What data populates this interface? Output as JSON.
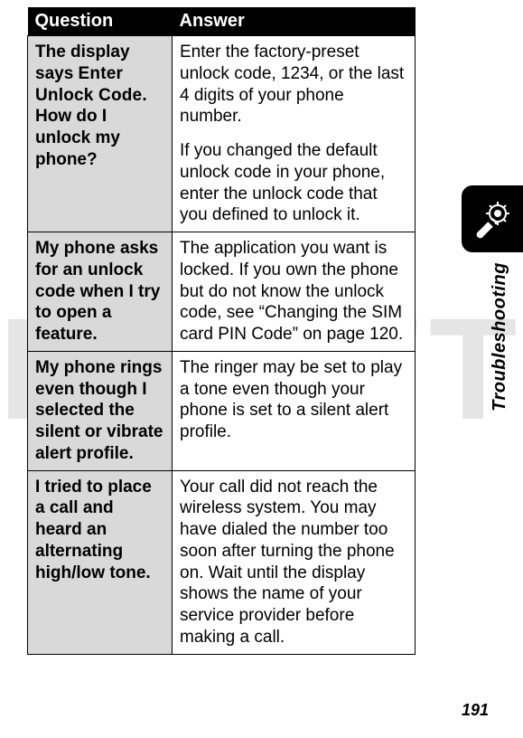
{
  "watermark": "DRAFT",
  "table": {
    "headers": {
      "question": "Question",
      "answer": "Answer"
    },
    "rows": [
      {
        "question_pre": "The display says ",
        "question_mono": "Enter Unlock Code",
        "question_post": ". How do I unlock my phone?",
        "answer_p1": "Enter the factory-preset unlock code, 1234, or the last 4 digits of your phone number.",
        "answer_p2": "If you changed the default unlock code in your phone, enter the unlock code that you defined to unlock it."
      },
      {
        "question": "My phone asks for an unlock code when I try to open a feature.",
        "answer": "The application you want is locked. If you own the phone but do not know the unlock code, see “Changing the SIM card PIN Code” on page 120."
      },
      {
        "question": "My phone rings even though I selected the silent or vibrate alert profile.",
        "answer": "The ringer may be set to play a tone even though your phone is set to a silent alert profile."
      },
      {
        "question": "I tried to place a call and heard an alternating high/low tone.",
        "answer": "Your call did not reach the wireless system. You may have dialed the number too soon after turning the phone on. Wait until the display shows the name of your service provider before making a call."
      }
    ]
  },
  "side": {
    "icon_name": "wrench-target-icon",
    "label": "Troubleshooting"
  },
  "page_number": "191"
}
